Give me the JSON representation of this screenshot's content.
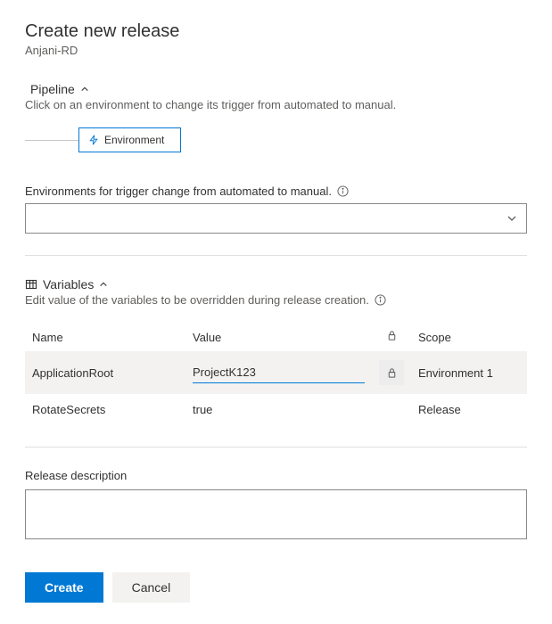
{
  "title": "Create new release",
  "subtitle": "Anjani-RD",
  "pipeline": {
    "label": "Pipeline",
    "caption": "Click on an environment to change its trigger from automated to manual.",
    "node_label": "Environment"
  },
  "environments": {
    "label": "Environments for trigger change from automated to manual.",
    "selected": ""
  },
  "variables": {
    "label": "Variables",
    "caption": "Edit value of the variables to be overridden during release creation.",
    "headers": {
      "name": "Name",
      "value": "Value",
      "scope": "Scope"
    },
    "rows": [
      {
        "name": "ApplicationRoot",
        "value": "ProjectK123",
        "scope": "Environment 1",
        "secret": false,
        "editing": true
      },
      {
        "name": "RotateSecrets",
        "value": "true",
        "scope": "Release",
        "secret": false,
        "editing": false
      }
    ]
  },
  "release_description": {
    "label": "Release description",
    "value": ""
  },
  "buttons": {
    "create": "Create",
    "cancel": "Cancel"
  }
}
